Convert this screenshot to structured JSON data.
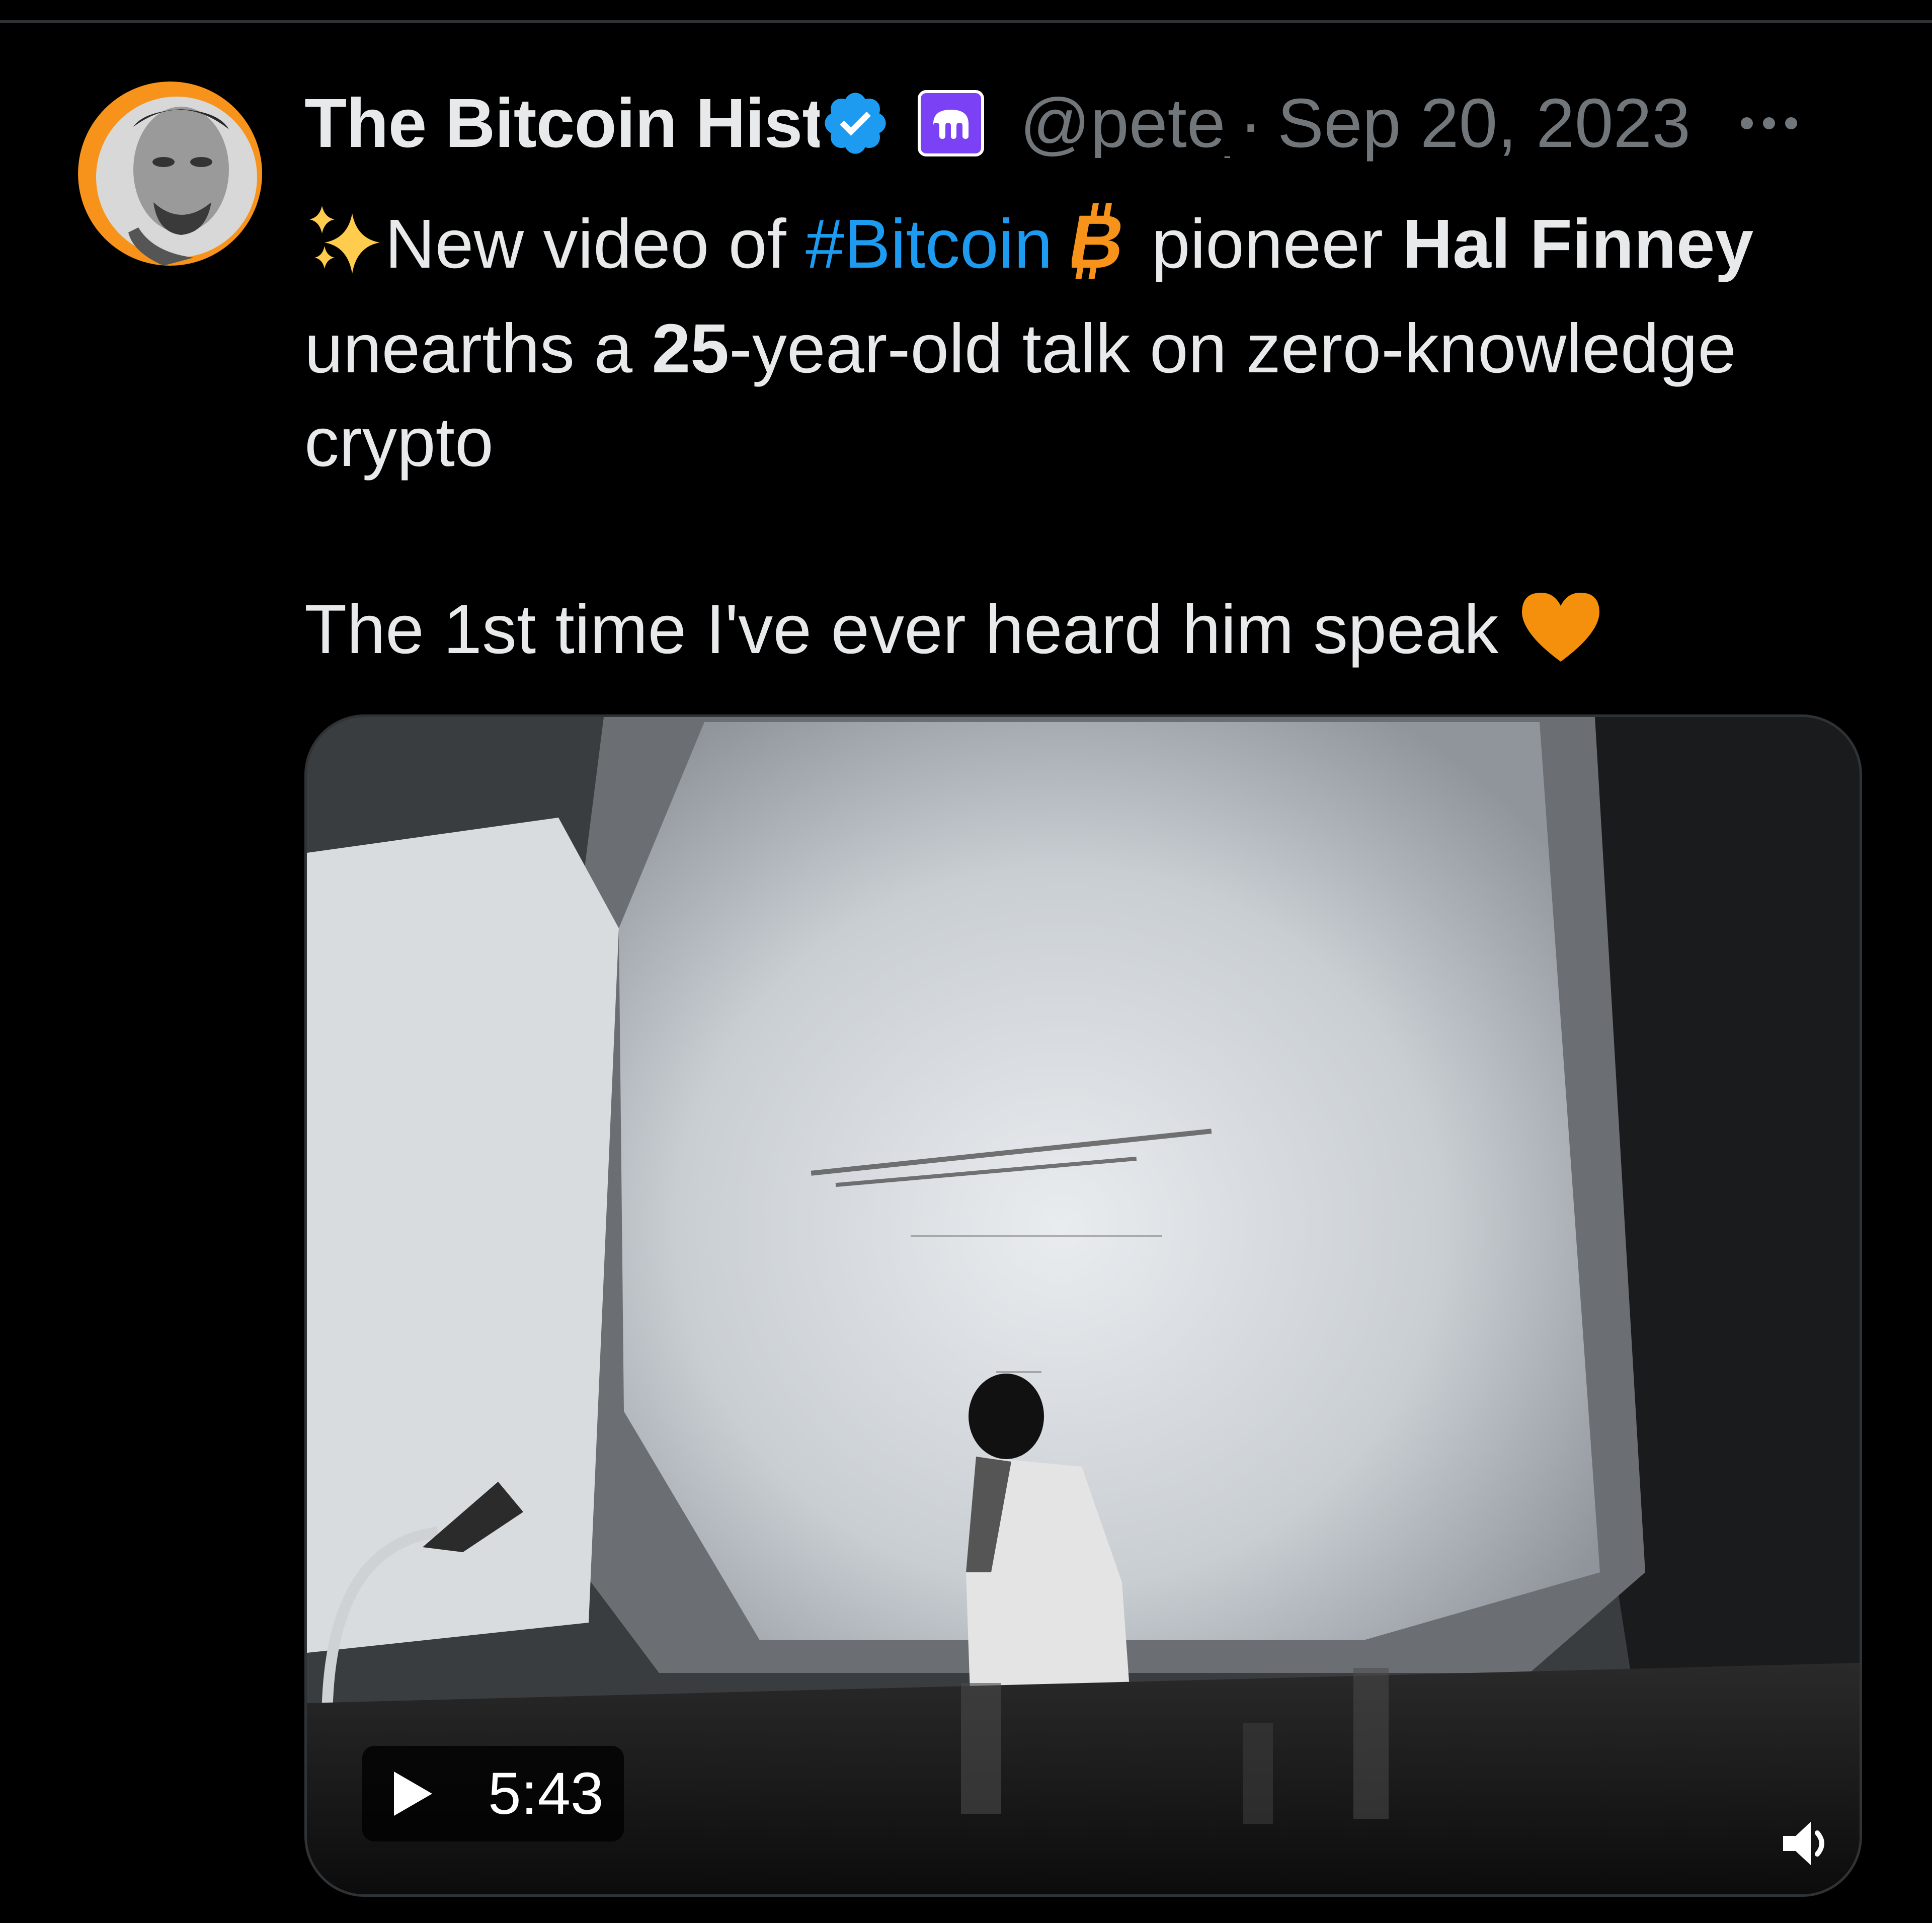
{
  "tweet": {
    "author": {
      "display_name": "The Bitcoin Hist",
      "handle": "@pete_",
      "verified_icon": "verified-badge-icon",
      "affiliate_icon": "kraken-affiliate-icon",
      "avatar": "avatar-photo"
    },
    "separator": "·",
    "timestamp": "Sep 20, 2023",
    "more_icon": "more-options-icon",
    "text": {
      "line1_sparkles": "sparkles-emoji",
      "line1_a": "New video of ",
      "line1_hashtag": "#Bitcoin",
      "line1_bitcoin_icon": "bitcoin-symbol-icon",
      "line1_b": " pioneer ",
      "line1_bold": "Hal Finney",
      "line2_a": "unearths a ",
      "line2_bold": "25",
      "line2_b": "-year-old talk on zero-knowledge",
      "line3": "crypto",
      "line4": "The 1st time I've ever heard him speak ",
      "line4_heart": "orange-heart-emoji"
    },
    "media": {
      "type": "video",
      "duration": "5:43",
      "play_icon": "play-icon",
      "volume_icon": "volume-icon"
    }
  },
  "colors": {
    "background": "#000000",
    "text": "#e7e9ea",
    "secondary": "#71767b",
    "link": "#1d9bf0",
    "verified": "#1d9bf0",
    "bitcoin_orange": "#f7931a",
    "heart": "#f4900c",
    "affiliate_purple": "#7b41f5"
  }
}
